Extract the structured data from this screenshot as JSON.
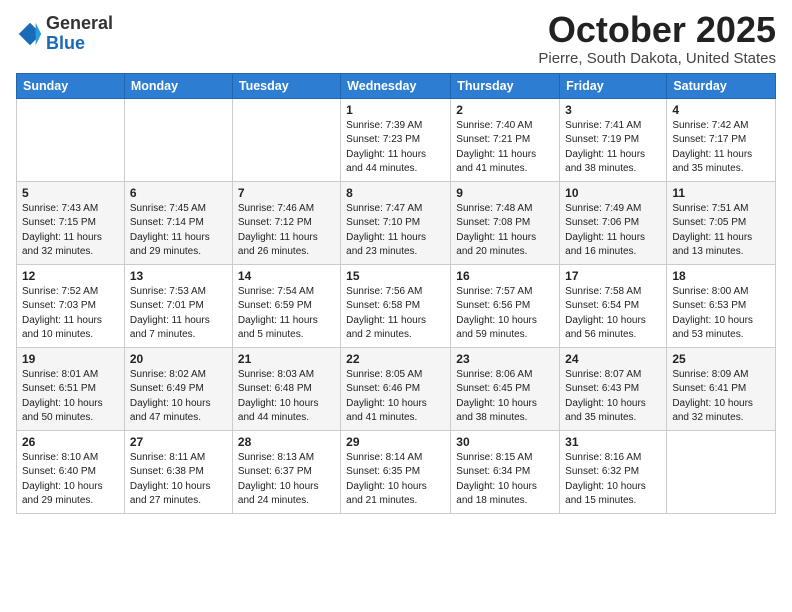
{
  "header": {
    "logo_general": "General",
    "logo_blue": "Blue",
    "month": "October 2025",
    "location": "Pierre, South Dakota, United States"
  },
  "weekdays": [
    "Sunday",
    "Monday",
    "Tuesday",
    "Wednesday",
    "Thursday",
    "Friday",
    "Saturday"
  ],
  "weeks": [
    [
      {
        "day": "",
        "info": ""
      },
      {
        "day": "",
        "info": ""
      },
      {
        "day": "",
        "info": ""
      },
      {
        "day": "1",
        "info": "Sunrise: 7:39 AM\nSunset: 7:23 PM\nDaylight: 11 hours\nand 44 minutes."
      },
      {
        "day": "2",
        "info": "Sunrise: 7:40 AM\nSunset: 7:21 PM\nDaylight: 11 hours\nand 41 minutes."
      },
      {
        "day": "3",
        "info": "Sunrise: 7:41 AM\nSunset: 7:19 PM\nDaylight: 11 hours\nand 38 minutes."
      },
      {
        "day": "4",
        "info": "Sunrise: 7:42 AM\nSunset: 7:17 PM\nDaylight: 11 hours\nand 35 minutes."
      }
    ],
    [
      {
        "day": "5",
        "info": "Sunrise: 7:43 AM\nSunset: 7:15 PM\nDaylight: 11 hours\nand 32 minutes."
      },
      {
        "day": "6",
        "info": "Sunrise: 7:45 AM\nSunset: 7:14 PM\nDaylight: 11 hours\nand 29 minutes."
      },
      {
        "day": "7",
        "info": "Sunrise: 7:46 AM\nSunset: 7:12 PM\nDaylight: 11 hours\nand 26 minutes."
      },
      {
        "day": "8",
        "info": "Sunrise: 7:47 AM\nSunset: 7:10 PM\nDaylight: 11 hours\nand 23 minutes."
      },
      {
        "day": "9",
        "info": "Sunrise: 7:48 AM\nSunset: 7:08 PM\nDaylight: 11 hours\nand 20 minutes."
      },
      {
        "day": "10",
        "info": "Sunrise: 7:49 AM\nSunset: 7:06 PM\nDaylight: 11 hours\nand 16 minutes."
      },
      {
        "day": "11",
        "info": "Sunrise: 7:51 AM\nSunset: 7:05 PM\nDaylight: 11 hours\nand 13 minutes."
      }
    ],
    [
      {
        "day": "12",
        "info": "Sunrise: 7:52 AM\nSunset: 7:03 PM\nDaylight: 11 hours\nand 10 minutes."
      },
      {
        "day": "13",
        "info": "Sunrise: 7:53 AM\nSunset: 7:01 PM\nDaylight: 11 hours\nand 7 minutes."
      },
      {
        "day": "14",
        "info": "Sunrise: 7:54 AM\nSunset: 6:59 PM\nDaylight: 11 hours\nand 5 minutes."
      },
      {
        "day": "15",
        "info": "Sunrise: 7:56 AM\nSunset: 6:58 PM\nDaylight: 11 hours\nand 2 minutes."
      },
      {
        "day": "16",
        "info": "Sunrise: 7:57 AM\nSunset: 6:56 PM\nDaylight: 10 hours\nand 59 minutes."
      },
      {
        "day": "17",
        "info": "Sunrise: 7:58 AM\nSunset: 6:54 PM\nDaylight: 10 hours\nand 56 minutes."
      },
      {
        "day": "18",
        "info": "Sunrise: 8:00 AM\nSunset: 6:53 PM\nDaylight: 10 hours\nand 53 minutes."
      }
    ],
    [
      {
        "day": "19",
        "info": "Sunrise: 8:01 AM\nSunset: 6:51 PM\nDaylight: 10 hours\nand 50 minutes."
      },
      {
        "day": "20",
        "info": "Sunrise: 8:02 AM\nSunset: 6:49 PM\nDaylight: 10 hours\nand 47 minutes."
      },
      {
        "day": "21",
        "info": "Sunrise: 8:03 AM\nSunset: 6:48 PM\nDaylight: 10 hours\nand 44 minutes."
      },
      {
        "day": "22",
        "info": "Sunrise: 8:05 AM\nSunset: 6:46 PM\nDaylight: 10 hours\nand 41 minutes."
      },
      {
        "day": "23",
        "info": "Sunrise: 8:06 AM\nSunset: 6:45 PM\nDaylight: 10 hours\nand 38 minutes."
      },
      {
        "day": "24",
        "info": "Sunrise: 8:07 AM\nSunset: 6:43 PM\nDaylight: 10 hours\nand 35 minutes."
      },
      {
        "day": "25",
        "info": "Sunrise: 8:09 AM\nSunset: 6:41 PM\nDaylight: 10 hours\nand 32 minutes."
      }
    ],
    [
      {
        "day": "26",
        "info": "Sunrise: 8:10 AM\nSunset: 6:40 PM\nDaylight: 10 hours\nand 29 minutes."
      },
      {
        "day": "27",
        "info": "Sunrise: 8:11 AM\nSunset: 6:38 PM\nDaylight: 10 hours\nand 27 minutes."
      },
      {
        "day": "28",
        "info": "Sunrise: 8:13 AM\nSunset: 6:37 PM\nDaylight: 10 hours\nand 24 minutes."
      },
      {
        "day": "29",
        "info": "Sunrise: 8:14 AM\nSunset: 6:35 PM\nDaylight: 10 hours\nand 21 minutes."
      },
      {
        "day": "30",
        "info": "Sunrise: 8:15 AM\nSunset: 6:34 PM\nDaylight: 10 hours\nand 18 minutes."
      },
      {
        "day": "31",
        "info": "Sunrise: 8:16 AM\nSunset: 6:32 PM\nDaylight: 10 hours\nand 15 minutes."
      },
      {
        "day": "",
        "info": ""
      }
    ]
  ]
}
